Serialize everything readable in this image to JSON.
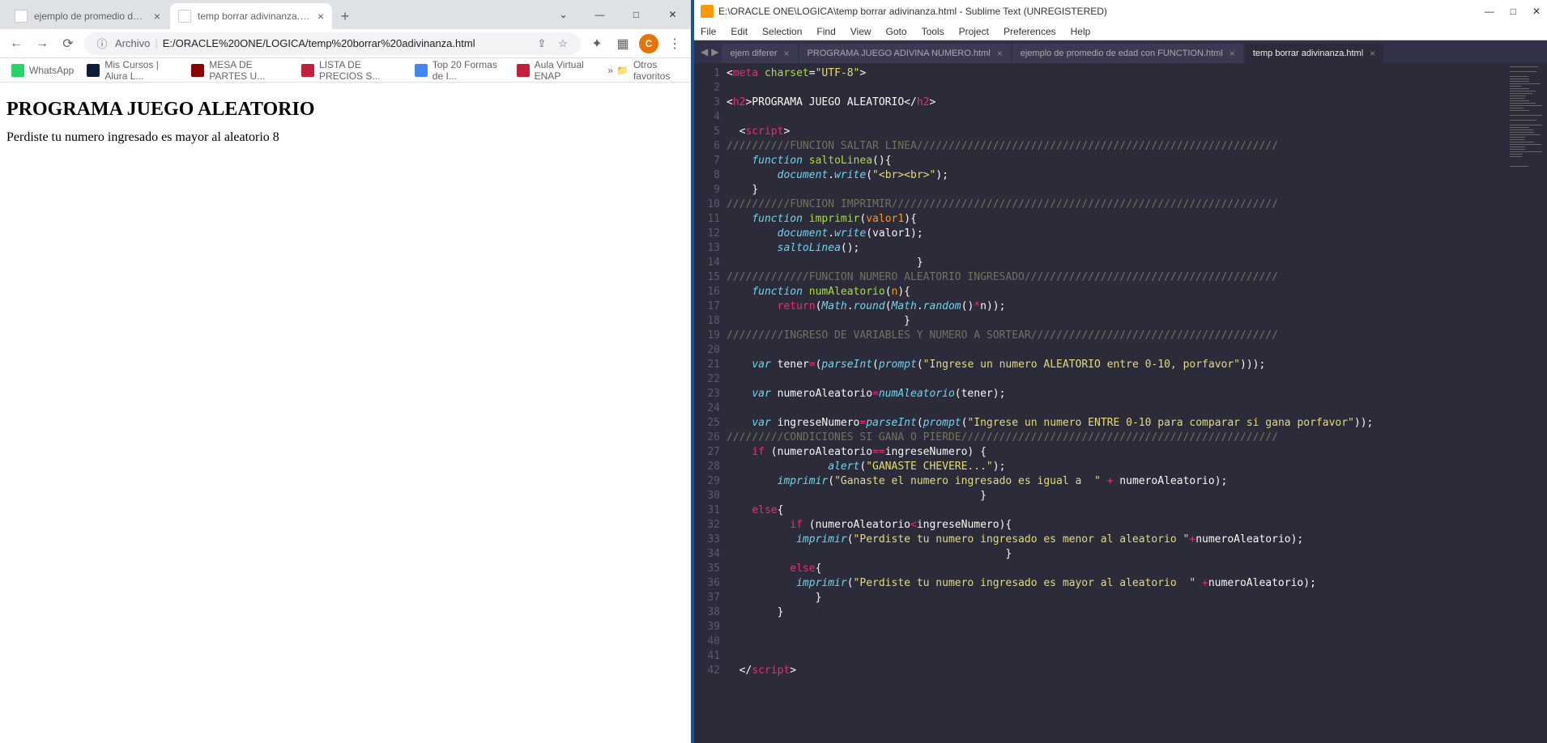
{
  "chrome": {
    "tabs": [
      {
        "title": "ejemplo de promedio de edad c",
        "active": false
      },
      {
        "title": "temp borrar adivinanza.html",
        "active": true
      }
    ],
    "window_controls": {
      "caret": "⌄",
      "min": "—",
      "max": "□",
      "close": "✕"
    },
    "nav": {
      "back": "←",
      "fwd": "→",
      "reload": "⟳"
    },
    "addr_prefix": "Archivo",
    "addr_url": "E:/ORACLE%20ONE/LOGICA/temp%20borrar%20adivinanza.html",
    "addr_info_icon": "ⓘ",
    "share_icon": "⇪",
    "star_icon": "☆",
    "ext_icon": "✦",
    "puzzle_icon": "▦",
    "avatar": "C",
    "bookmarks": [
      {
        "label": "WhatsApp",
        "color": "#25d366"
      },
      {
        "label": "Mis Cursos | Alura L...",
        "color": "#0e1e3a"
      },
      {
        "label": "MESA DE PARTES U...",
        "color": "#8b0000"
      },
      {
        "label": "LISTA DE PRECIOS S...",
        "color": "#c41e3a"
      },
      {
        "label": "Top 20 Formas de I...",
        "color": "#4285f4"
      },
      {
        "label": "Aula Virtual ENAP",
        "color": "#c41e3a"
      }
    ],
    "bookmark_more": "»",
    "bookmark_folder": "Otros favoritos",
    "page": {
      "heading": "PROGRAMA JUEGO ALEATORIO",
      "body_text": "Perdiste tu numero ingresado es mayor al aleatorio 8"
    }
  },
  "sublime": {
    "title": "E:\\ORACLE ONE\\LOGICA\\temp borrar adivinanza.html - Sublime Text (UNREGISTERED)",
    "menu": [
      "File",
      "Edit",
      "Selection",
      "Find",
      "View",
      "Goto",
      "Tools",
      "Project",
      "Preferences",
      "Help"
    ],
    "win_controls": {
      "min": "—",
      "max": "□",
      "close": "✕"
    },
    "tabs": [
      {
        "title": "ejem diferer",
        "active": false
      },
      {
        "title": "PROGRAMA JUEGO ADIVINA NUMERO.html",
        "active": false
      },
      {
        "title": "ejemplo de promedio de edad con FUNCTION.html",
        "active": false
      },
      {
        "title": "temp borrar adivinanza.html",
        "active": true
      }
    ],
    "line_count": 42,
    "code_lines": [
      {
        "n": 1,
        "html": "<span class='c-white'>&lt;</span><span class='c-red'>meta</span> <span class='c-green'>charset</span><span class='c-white'>=</span><span class='c-yellow'>\"UTF-8\"</span><span class='c-white'>&gt;</span>"
      },
      {
        "n": 2,
        "html": ""
      },
      {
        "n": 3,
        "html": "<span class='c-white'>&lt;</span><span class='c-red'>h2</span><span class='c-white'>&gt;PROGRAMA JUEGO ALEATORIO&lt;/</span><span class='c-red'>h2</span><span class='c-white'>&gt;</span>"
      },
      {
        "n": 4,
        "html": ""
      },
      {
        "n": 5,
        "html": "  <span class='c-white'>&lt;</span><span class='c-red'>script</span><span class='c-white'>&gt;</span>"
      },
      {
        "n": 6,
        "html": "<span class='c-gray'>//////////FUNCION SALTAR LINEA/////////////////////////////////////////////////////////</span>"
      },
      {
        "n": 7,
        "html": "    <span class='c-blue'>function</span> <span class='c-green'>saltoLinea</span><span class='c-white'>(){</span>"
      },
      {
        "n": 8,
        "html": "        <span class='c-blue'>document</span><span class='c-white'>.</span><span class='c-blue'>write</span><span class='c-white'>(</span><span class='c-yellow'>\"&lt;br&gt;&lt;br&gt;\"</span><span class='c-white'>);</span>"
      },
      {
        "n": 9,
        "html": "    <span class='c-white'>}</span>"
      },
      {
        "n": 10,
        "html": "<span class='c-gray'>//////////FUNCION IMPRIMIR/////////////////////////////////////////////////////////////</span>"
      },
      {
        "n": 11,
        "html": "    <span class='c-blue'>function</span> <span class='c-green'>imprimir</span><span class='c-white'>(</span><span class='c-orange'>valor1</span><span class='c-white'>){</span>"
      },
      {
        "n": 12,
        "html": "        <span class='c-blue'>document</span><span class='c-white'>.</span><span class='c-blue'>write</span><span class='c-white'>(valor1);</span>"
      },
      {
        "n": 13,
        "html": "        <span class='c-blue'>saltoLinea</span><span class='c-white'>();</span>"
      },
      {
        "n": 14,
        "html": "                              <span class='c-white'>}</span>"
      },
      {
        "n": 15,
        "html": "<span class='c-gray'>/////////////FUNCION NUMERO ALEATORIO INGRESADO////////////////////////////////////////</span>"
      },
      {
        "n": 16,
        "html": "    <span class='c-blue'>function</span> <span class='c-green'>numAleatorio</span><span class='c-white'>(</span><span class='c-orange'>n</span><span class='c-white'>){</span>"
      },
      {
        "n": 17,
        "html": "        <span class='c-red'>return</span><span class='c-white'>(</span><span class='c-blue'>Math</span><span class='c-white'>.</span><span class='c-blue'>round</span><span class='c-white'>(</span><span class='c-blue'>Math</span><span class='c-white'>.</span><span class='c-blue'>random</span><span class='c-white'>()</span><span class='c-red'>*</span><span class='c-white'>n));</span>"
      },
      {
        "n": 18,
        "html": "                            <span class='c-white'>}</span>"
      },
      {
        "n": 19,
        "html": "<span class='c-gray'>/////////INGRESO DE VARIABLES Y NUMERO A SORTEAR///////////////////////////////////////</span>"
      },
      {
        "n": 20,
        "html": ""
      },
      {
        "n": 21,
        "html": "    <span class='c-blue'>var</span> <span class='c-white'>tener</span><span class='c-red'>=</span><span class='c-white'>(</span><span class='c-blue'>parseInt</span><span class='c-white'>(</span><span class='c-blue'>prompt</span><span class='c-white'>(</span><span class='c-yellow'>\"Ingrese un numero ALEATORIO entre 0-10, porfavor\"</span><span class='c-white'>)));</span>"
      },
      {
        "n": 22,
        "html": ""
      },
      {
        "n": 23,
        "html": "    <span class='c-blue'>var</span> <span class='c-white'>numeroAleatorio</span><span class='c-red'>=</span><span class='c-blue'>numAleatorio</span><span class='c-white'>(tener);</span>"
      },
      {
        "n": 24,
        "html": ""
      },
      {
        "n": 25,
        "html": "    <span class='c-blue'>var</span> <span class='c-white'>ingreseNumero</span><span class='c-red'>=</span><span class='c-blue'>parseInt</span><span class='c-white'>(</span><span class='c-blue'>prompt</span><span class='c-white'>(</span><span class='c-yellow'>\"Ingrese un numero ENTRE 0-10 para comparar si gana porfavor\"</span><span class='c-white'>));</span>"
      },
      {
        "n": 26,
        "html": "<span class='c-gray'>/////////CONDICIONES SI GANA O PIERDE//////////////////////////////////////////////////</span>"
      },
      {
        "n": 27,
        "html": "    <span class='c-red'>if</span> <span class='c-white'>(numeroAleatorio</span><span class='c-red'>==</span><span class='c-white'>ingreseNumero) {</span>"
      },
      {
        "n": 28,
        "html": "                <span class='c-blue'>alert</span><span class='c-white'>(</span><span class='c-yellow'>\"GANASTE CHEVERE...\"</span><span class='c-white'>);</span>"
      },
      {
        "n": 29,
        "html": "        <span class='c-blue'>imprimir</span><span class='c-white'>(</span><span class='c-yellow'>\"Ganaste el numero ingresado es igual a  \"</span> <span class='c-red'>+</span> <span class='c-white'>numeroAleatorio);</span>"
      },
      {
        "n": 30,
        "html": "                                        <span class='c-white'>}</span>"
      },
      {
        "n": 31,
        "html": "    <span class='c-red'>else</span><span class='c-white'>{</span>"
      },
      {
        "n": 32,
        "html": "          <span class='c-red'>if</span> <span class='c-white'>(numeroAleatorio</span><span class='c-red'>&lt;</span><span class='c-white'>ingreseNumero){</span>"
      },
      {
        "n": 33,
        "html": "           <span class='c-blue'>imprimir</span><span class='c-white'>(</span><span class='c-yellow'>\"Perdiste tu numero ingresado es menor al aleatorio \"</span><span class='c-red'>+</span><span class='c-white'>numeroAleatorio);</span>"
      },
      {
        "n": 34,
        "html": "                                            <span class='c-white'>}</span>"
      },
      {
        "n": 35,
        "html": "          <span class='c-red'>else</span><span class='c-white'>{</span>"
      },
      {
        "n": 36,
        "html": "           <span class='c-blue'>imprimir</span><span class='c-white'>(</span><span class='c-yellow'>\"Perdiste tu numero ingresado es mayor al aleatorio  \"</span> <span class='c-red'>+</span><span class='c-white'>numeroAleatorio);</span>"
      },
      {
        "n": 37,
        "html": "              <span class='c-white'>}</span>"
      },
      {
        "n": 38,
        "html": "        <span class='c-white'>}</span>"
      },
      {
        "n": 39,
        "html": ""
      },
      {
        "n": 40,
        "html": ""
      },
      {
        "n": 41,
        "html": ""
      },
      {
        "n": 42,
        "html": "  <span class='c-white'>&lt;/</span><span class='c-red'>script</span><span class='c-white'>&gt;</span>"
      }
    ]
  }
}
